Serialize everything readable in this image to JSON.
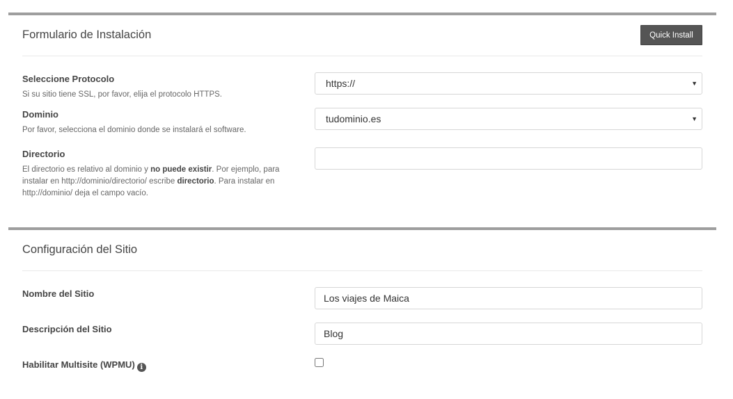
{
  "install_form": {
    "title": "Formulario de Instalación",
    "quick_install_label": "Quick Install",
    "protocol": {
      "label": "Seleccione Protocolo",
      "help": "Si su sitio tiene SSL, por favor, elija el protocolo HTTPS.",
      "value": "https://"
    },
    "domain": {
      "label": "Dominio",
      "help": "Por favor, selecciona el dominio donde se instalará el software.",
      "value": "tudominio.es"
    },
    "directory": {
      "label": "Directorio",
      "help_part1": "El directorio es relativo al dominio y ",
      "help_bold1": "no puede existir",
      "help_part2": ". Por ejemplo, para instalar en http://dominio/directorio/ escribe ",
      "help_bold2": "directorio",
      "help_part3": ". Para instalar en http://dominio/ deja el campo vacío.",
      "value": ""
    }
  },
  "site_config": {
    "title": "Configuración del Sitio",
    "site_name": {
      "label": "Nombre del Sitio",
      "value": "Los viajes de Maica"
    },
    "site_description": {
      "label": "Descripción del Sitio",
      "value": "Blog"
    },
    "multisite": {
      "label": "Habilitar Multisite (WPMU)",
      "icon": "info-icon",
      "checked": false
    }
  },
  "colors": {
    "section_border": "#9e9e9e",
    "button_bg": "#555555",
    "button_text": "#ffffff"
  }
}
